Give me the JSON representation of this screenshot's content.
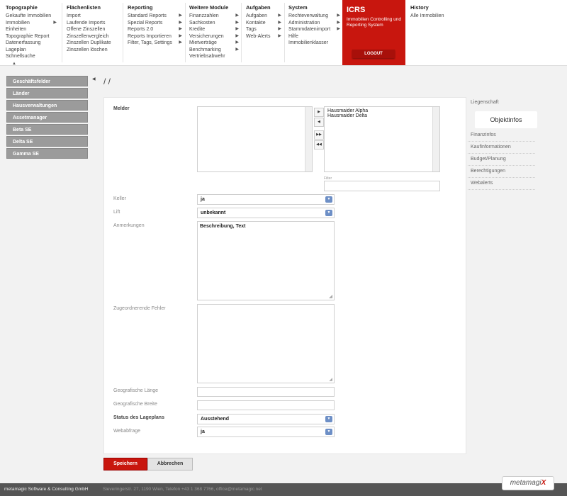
{
  "nav": {
    "columns": [
      {
        "title": "Topographie",
        "items": [
          "Gekaufte Immobilien",
          "Immobilien",
          "Einheiten",
          "Topographie Report",
          "Datenerfassung",
          "Lageplan",
          "Schnellsuche"
        ],
        "arrows": [
          1
        ]
      },
      {
        "title": "Flächenlisten",
        "items": [
          "Import",
          "Laufende Imports",
          "Offene Zinszellen",
          "Zinszellenvergleich",
          "Zinszellen Duplikate",
          "Zinszellen löschen"
        ],
        "arrows": []
      },
      {
        "title": "Reporting",
        "items": [
          "Standard Reports",
          "Spezial Reports",
          "Reports 2.0",
          "Reports Importieren",
          "Filter, Tags, Settings"
        ],
        "arrows": [
          0,
          1,
          2,
          3,
          4
        ]
      },
      {
        "title": "Weitere Module",
        "items": [
          "Finanzzahlen",
          "Sachkosten",
          "Kredite",
          "Versicherungen",
          "Mietverträge",
          "Benchmarking",
          "Vertriebsabwehr"
        ],
        "arrows": [
          0,
          1,
          2,
          3,
          4,
          5
        ]
      },
      {
        "title": "Aufgaben",
        "items": [
          "Aufgaben",
          "Kontakte",
          "Tags",
          "Web-Alerts"
        ],
        "arrows": [
          0,
          1,
          2,
          3
        ]
      },
      {
        "title": "System",
        "items": [
          "Rechteverwaltung",
          "Administration",
          "Stammdatenimport",
          "Hilfe",
          "Immobilienklasser"
        ],
        "arrows": [
          0,
          1,
          2
        ]
      },
      {
        "title": "History",
        "items": [
          "Alle Immobilien"
        ],
        "arrows": []
      }
    ]
  },
  "brand": {
    "title": "ICRS",
    "subtitle": "Immobilien Controlling und Reporting System",
    "logout": "LOGOUT",
    "accent": "#c8160e"
  },
  "sidebar": {
    "items": [
      "Geschäftsfelder",
      "Länder",
      "Hausverwaltungen",
      "Assetmanager",
      "Beta SE",
      "Delta SE",
      "Gamma SE"
    ]
  },
  "breadcrumb": "/ /",
  "form": {
    "melder_label": "Melder",
    "melder_selected": [
      "Hausmaider Alpha",
      "Hausmaider Delta"
    ],
    "filter_label": "Filter",
    "keller_label": "Keller",
    "keller_value": "ja",
    "lift_label": "Lift",
    "lift_value": "unbekannt",
    "anmerkungen_label": "Anmerkungen",
    "anmerkungen_value": "Beschreibung, Text",
    "zugeordnete_label": "Zugeordnerende Fehler",
    "laenge_label": "Geografische Länge",
    "breite_label": "Geografische Breite",
    "status_label": "Status des Lageplans",
    "status_value": "Ausstehend",
    "webabfrage_label": "Webabfrage",
    "webabfrage_value": "ja"
  },
  "rightnav": {
    "items": [
      "Liegenschaft",
      "Objektinfos",
      "Finanzinfos",
      "Kaufinformationen",
      "Budget/Planung",
      "Berechtigungen",
      "Webalerts"
    ],
    "active": "Objektinfos"
  },
  "buttons": {
    "save": "Speichern",
    "cancel": "Abbrechen"
  },
  "footer": {
    "company": "metamagic Software & Consulting GmbH",
    "address": "Sieveringerstr. 27, 1190 Wien, Telefon +43 1 368 7766, office@metamagic.net"
  },
  "logo": {
    "text": "metamagi",
    "x": "X"
  }
}
